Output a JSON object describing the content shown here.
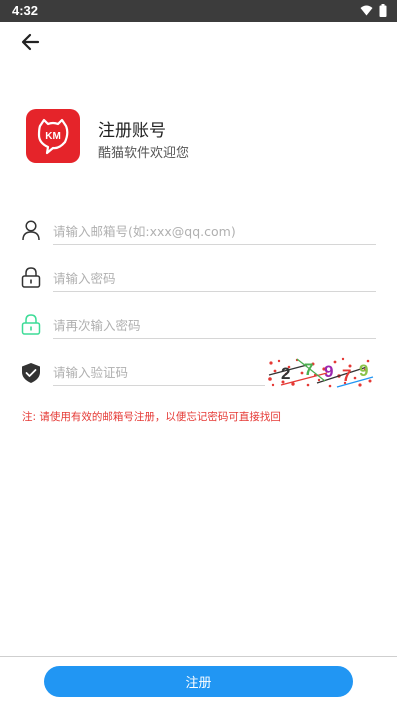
{
  "status_bar": {
    "time": "4:32"
  },
  "header": {
    "back_icon": "arrow-left-icon"
  },
  "app": {
    "logo_text": "KM",
    "title": "注册账号",
    "subtitle": "酷猫软件欢迎您"
  },
  "form": {
    "email": {
      "placeholder": "请输入邮箱号(如:xxx@qq.com)",
      "icon": "user-icon"
    },
    "password": {
      "placeholder": "请输入密码",
      "icon": "lock-icon"
    },
    "password_confirm": {
      "placeholder": "请再次输入密码",
      "icon": "lock-icon"
    },
    "captcha": {
      "placeholder": "请输入验证码",
      "icon": "shield-check-icon",
      "code_chars": [
        "2",
        "7",
        "9",
        "7",
        "9"
      ]
    }
  },
  "note": "注: 请使用有效的邮箱号注册，以便忘记密码可直接找回",
  "footer": {
    "register_label": "注册"
  },
  "colors": {
    "accent": "#2196f3",
    "brand": "#e5242a",
    "warning": "#e53935",
    "confirm_icon": "#3ddc97"
  }
}
